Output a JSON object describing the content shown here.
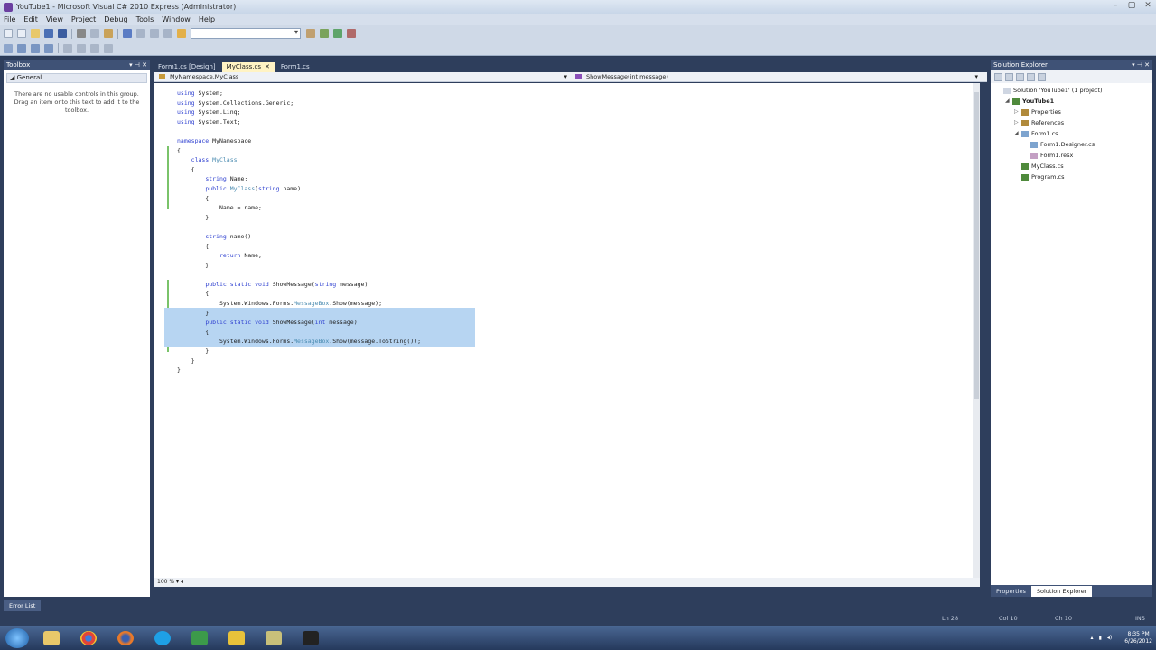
{
  "window": {
    "title": "YouTube1 - Microsoft Visual C# 2010 Express (Administrator)",
    "controls": [
      "–",
      "▢",
      "✕"
    ]
  },
  "menu": [
    "File",
    "Edit",
    "View",
    "Project",
    "Debug",
    "Tools",
    "Window",
    "Help"
  ],
  "toolbox": {
    "title": "Toolbox",
    "group": "General",
    "message": "There are no usable controls in this group. Drag an item onto this text to add it to the toolbox."
  },
  "tabs": [
    {
      "label": "Form1.cs [Design]"
    },
    {
      "label": "MyClass.cs"
    },
    {
      "label": "Form1.cs"
    }
  ],
  "navbar": {
    "types": "MyNamespace.MyClass",
    "members": "ShowMessage(int message)"
  },
  "code_lines": [
    "using System;",
    "using System.Collections.Generic;",
    "using System.Linq;",
    "using System.Text;",
    "",
    "namespace MyNamespace",
    "{",
    "    class MyClass",
    "    {",
    "        string Name;",
    "        public MyClass(string name)",
    "        {",
    "            Name = name;",
    "        }",
    "",
    "        string name()",
    "        {",
    "            return Name;",
    "        }",
    "",
    "        public static void ShowMessage(string message)",
    "        {",
    "            System.Windows.Forms.MessageBox.Show(message);",
    "        }",
    "        public static void ShowMessage(int message)",
    "        {",
    "            System.Windows.Forms.MessageBox.Show(message.ToString());",
    "        }",
    "    }",
    "}"
  ],
  "zoom": "100 %",
  "solution_explorer": {
    "title": "Solution Explorer",
    "nodes": [
      {
        "label": "Solution 'YouTube1' (1 project)",
        "level": 0,
        "expander": ""
      },
      {
        "label": "YouTube1",
        "level": 1,
        "expander": "◢"
      },
      {
        "label": "Properties",
        "level": 2,
        "expander": "▷"
      },
      {
        "label": "References",
        "level": 2,
        "expander": "▷"
      },
      {
        "label": "Form1.cs",
        "level": 2,
        "expander": "◢"
      },
      {
        "label": "Form1.Designer.cs",
        "level": 3,
        "expander": ""
      },
      {
        "label": "Form1.resx",
        "level": 3,
        "expander": ""
      },
      {
        "label": "MyClass.cs",
        "level": 2,
        "expander": ""
      },
      {
        "label": "Program.cs",
        "level": 2,
        "expander": ""
      }
    ],
    "bottom_tabs": [
      "Properties",
      "Solution Explorer"
    ]
  },
  "status": {
    "error_list": "Error List",
    "ln": "Ln 28",
    "col": "Col 10",
    "ch": "Ch 10",
    "mode": "INS"
  },
  "taskbar": {
    "time": "8:35 PM",
    "date": "6/26/2012"
  },
  "colors": {
    "frame": "#2e3e5c",
    "active_tab": "#fff3c4",
    "selection": "#b7d5f2",
    "keyword": "#2d3fd0",
    "type": "#4a8bb0"
  }
}
